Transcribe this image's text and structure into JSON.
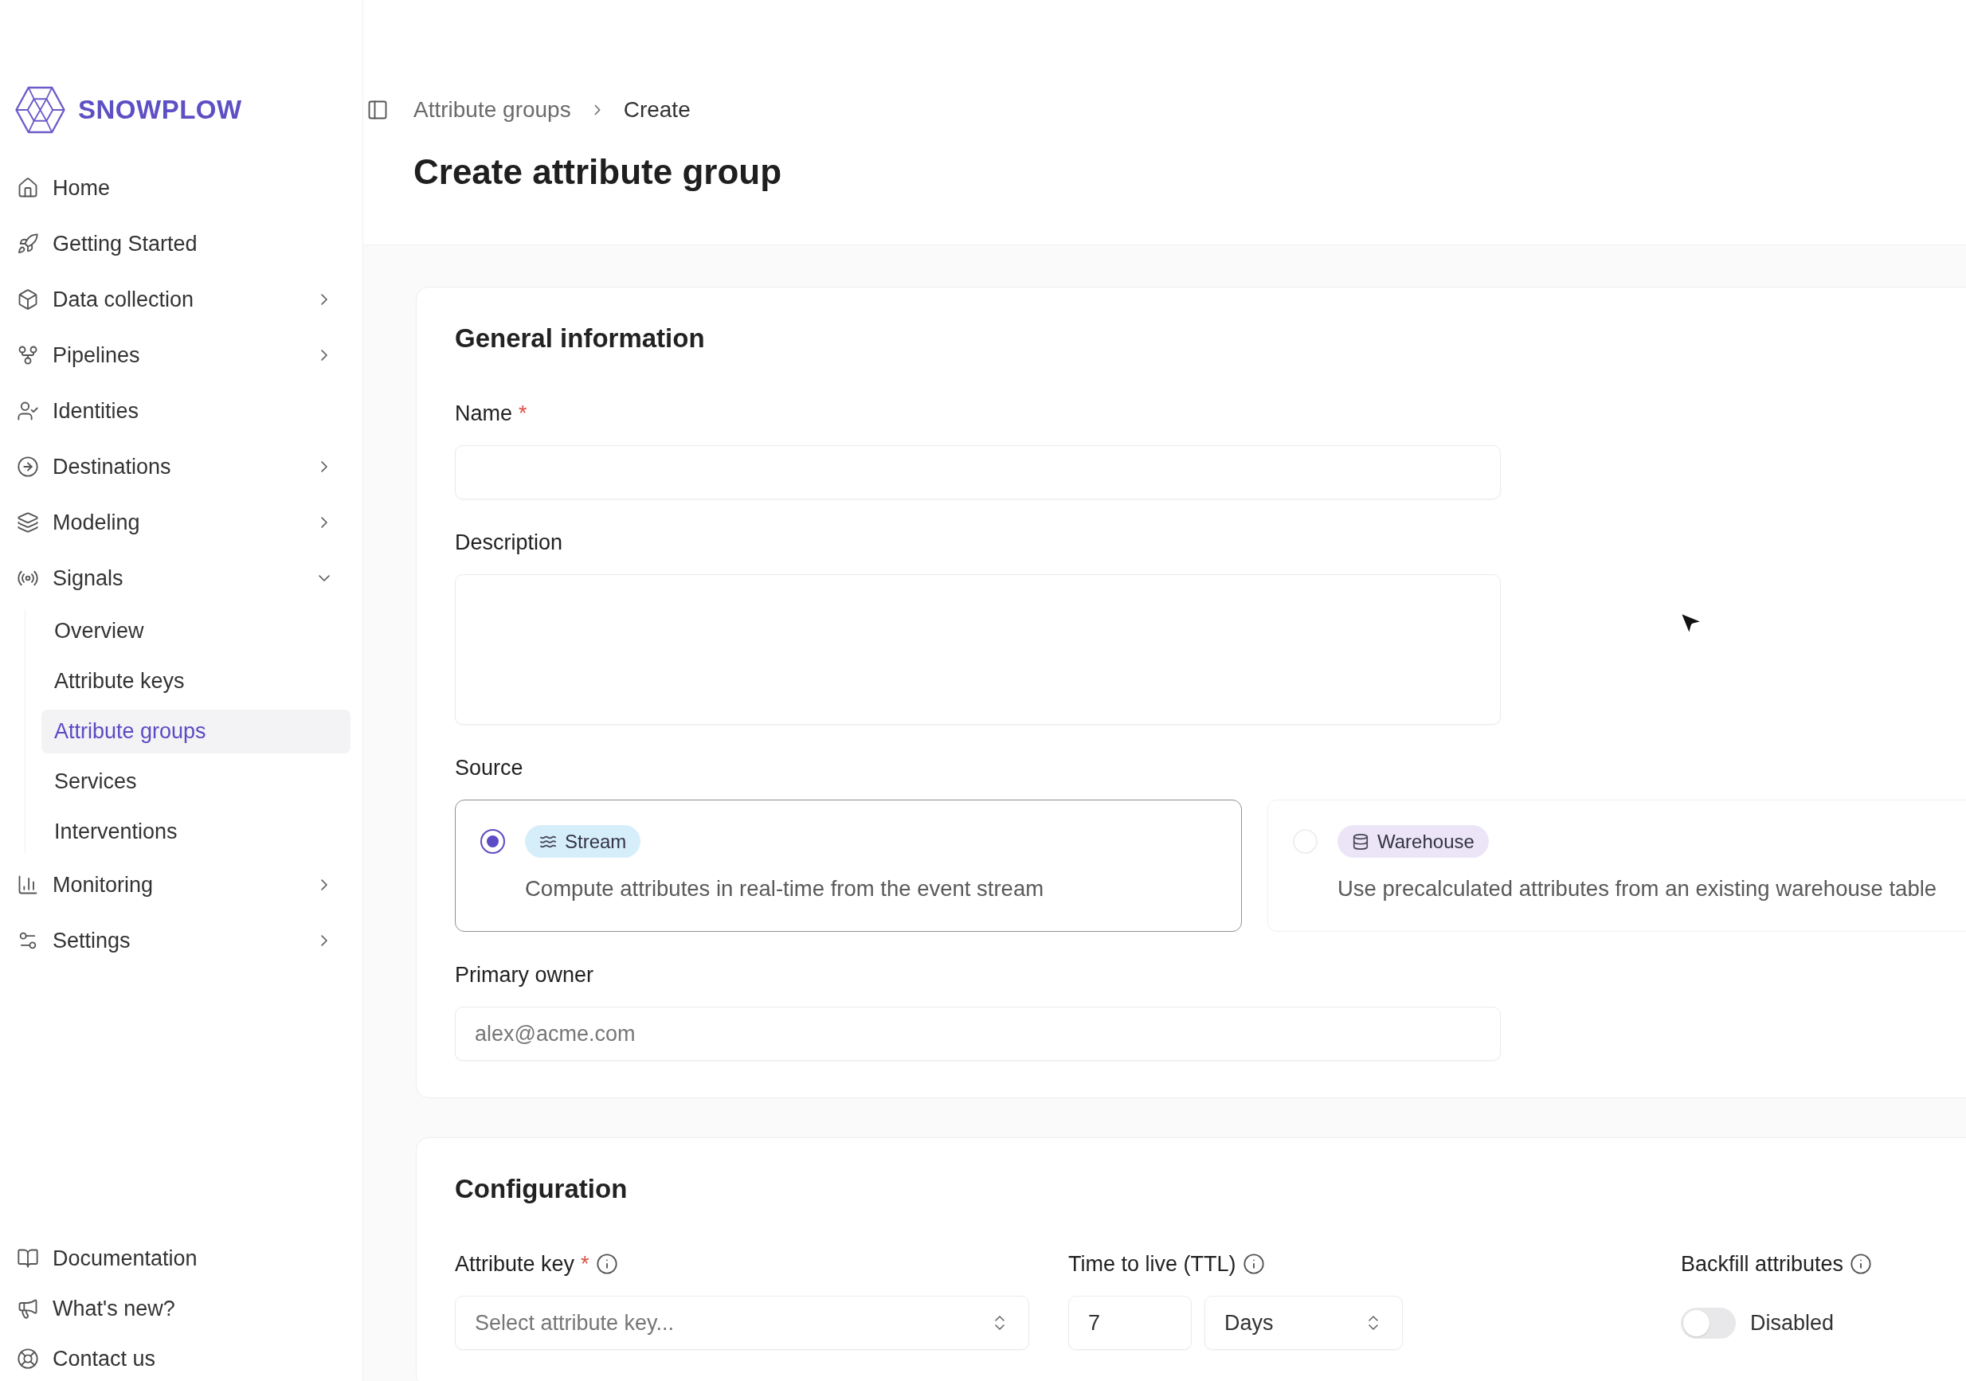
{
  "sidebar": {
    "logo": "SNOWPLOW",
    "items": [
      {
        "label": "Home",
        "kind": "link",
        "selected": false
      },
      {
        "label": "Getting Started",
        "kind": "link",
        "selected": false
      },
      {
        "label": "Data collection",
        "kind": "group",
        "expanded": false,
        "selected": false
      },
      {
        "label": "Pipelines",
        "kind": "group",
        "expanded": false,
        "selected": false
      },
      {
        "label": "Identities",
        "kind": "link",
        "selected": false
      },
      {
        "label": "Destinations",
        "kind": "group",
        "expanded": false,
        "selected": false
      },
      {
        "label": "Modeling",
        "kind": "group",
        "expanded": false,
        "selected": false
      },
      {
        "label": "Signals",
        "kind": "group",
        "expanded": true,
        "selected": false,
        "children": [
          {
            "label": "Overview",
            "selected": false
          },
          {
            "label": "Attribute keys",
            "selected": false
          },
          {
            "label": "Attribute groups",
            "selected": true
          },
          {
            "label": "Services",
            "selected": false
          },
          {
            "label": "Interventions",
            "selected": false
          }
        ]
      },
      {
        "label": "Monitoring",
        "kind": "group",
        "expanded": false,
        "selected": false
      },
      {
        "label": "Settings",
        "kind": "group",
        "expanded": false,
        "selected": false
      }
    ],
    "footer_items": [
      {
        "label": "Documentation"
      },
      {
        "label": "What's new?"
      },
      {
        "label": "Contact us"
      }
    ]
  },
  "header": {
    "breadcrumb": [
      {
        "label": "Attribute groups",
        "current": false
      },
      {
        "label": "Create",
        "current": true
      }
    ],
    "title": "Create attribute group"
  },
  "general": {
    "title": "General information",
    "name": {
      "label": "Name",
      "required_mark": "*"
    },
    "description": {
      "label": "Description"
    },
    "source": {
      "label": "Source",
      "options": [
        {
          "tag": "Stream",
          "description": "Compute attributes in real-time from the event stream",
          "selected": true,
          "color": "#d6eefa"
        },
        {
          "tag": "Warehouse",
          "description": "Use precalculated attributes from an existing warehouse table",
          "selected": false,
          "color": "#ebe5f7"
        }
      ]
    },
    "primary_owner": {
      "label": "Primary owner",
      "placeholder": "alex@acme.com"
    }
  },
  "configuration": {
    "title": "Configuration",
    "attribute_key": {
      "label": "Attribute key",
      "required_mark": "*",
      "placeholder": "Select attribute key..."
    },
    "ttl": {
      "label": "Time to live (TTL)",
      "value": "7",
      "unit": "Days"
    },
    "backfill": {
      "label": "Backfill attributes",
      "on": false,
      "status": "Disabled"
    }
  }
}
